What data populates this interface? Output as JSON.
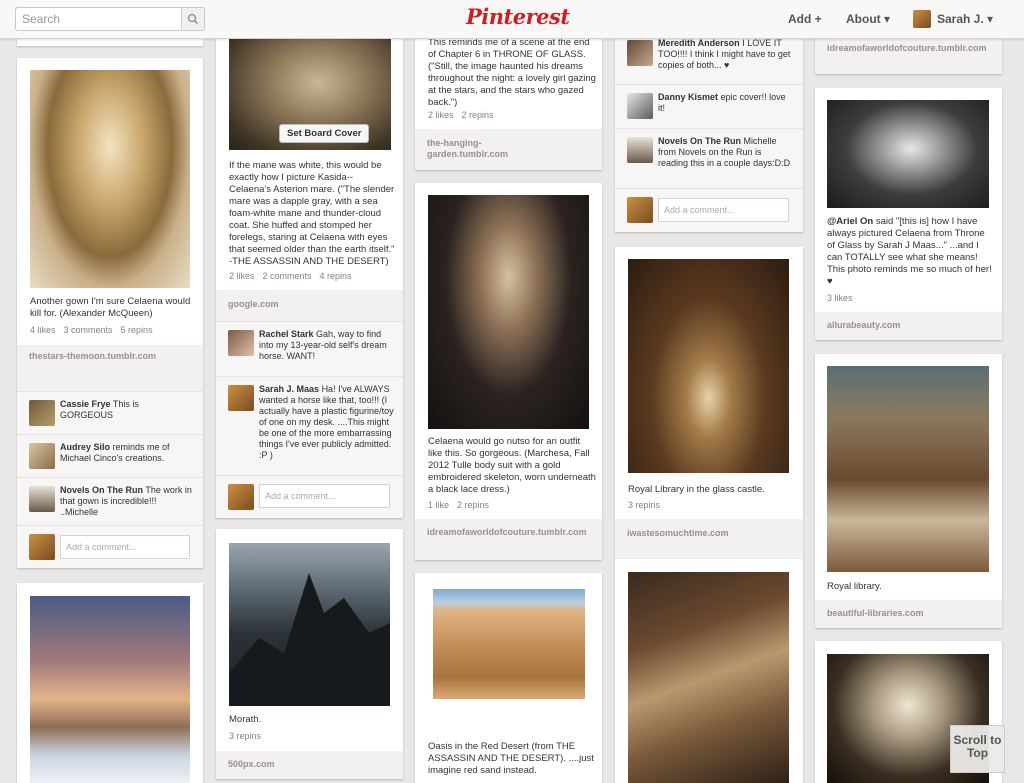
{
  "header": {
    "search_placeholder": "Search",
    "logo": "Pinterest",
    "add_label": "Add +",
    "about_label": "About ▾",
    "user_label": "Sarah J. ▾"
  },
  "pins": {
    "gown": {
      "desc": "Another gown I'm sure Celaena would kill for. (Alexander McQueen)",
      "likes": "4 likes",
      "comments": "3 comments",
      "repins": "5 repins",
      "source": "thestars-themoon.tumblr.com",
      "c1_name": "Cassie Frye",
      "c1_text": "This is GORGEOUS",
      "c2_name": "Audrey Silo",
      "c2_text": "reminds me of Michael Cinco's creations.",
      "c3_name": "Novels On The Run",
      "c3_text": "The work in that gown is incredible!!! ..Michelle",
      "add_comment": "Add a comment..."
    },
    "horse": {
      "set_cover": "Set Board Cover",
      "desc": "If the mane was white, this would be exactly how I picture Kasida--Celaena's Asterion mare. (\"The slender mare was a dapple gray, with a sea foam-white mane and thunder-cloud coat. She huffed and stomped her forelegs, staring at Celaena with eyes that seemed older than the earth itself.\" -THE ASSASSIN AND THE DESERT)",
      "likes": "2 likes",
      "comments": "2 comments",
      "repins": "4 repins",
      "source": "google.com",
      "c1_name": "Rachel Stark",
      "c1_text": "Gah, way to find into my 13-year-old self's dream horse. WANT!",
      "c2_name": "Sarah J. Maas",
      "c2_text": "Ha! I've ALWAYS wanted a horse like that, too!!! (I actually have a plastic figurine/toy of one on my desk. ....This might be one of the more embarrassing things I've ever publicly admitted. :P )",
      "add_comment": "Add a comment..."
    },
    "scene": {
      "desc": "This reminds me of a scene at the end of Chapter 6 in THRONE OF GLASS. (\"Still, the image haunted his dreams throughout the night: a lovely girl gazing at the stars, and the stars who gazed back.\")",
      "likes": "2 likes",
      "repins": "2 repins",
      "source": "the-hanging-garden.tumblr.com"
    },
    "skeleton": {
      "desc": "Celaena would go nutso for an outfit like this. So gorgeous. (Marchesa, Fall 2012 Tulle body suit with a gold embroidered skeleton, worn underneath a black lace dress.)",
      "likes": "1 like",
      "repins": "2 repins",
      "source": "idreamofaworldofcouture.tumblr.com"
    },
    "comments_top": {
      "c1_name": "Meredith Anderson",
      "c1_text": "I LOVE IT TOO!!!! I think I might have to get copies of both... ♥",
      "c2_name": "Danny Kismet",
      "c2_text": "epic cover!! love it!",
      "c3_name": "Novels On The Run",
      "c3_text": "Michelle from Novels on the Run is reading this in a couple days:D:D",
      "add_comment": "Add a comment..."
    },
    "library": {
      "desc": "Royal Library in the glass castle.",
      "repins": "3 repins",
      "source": "iwastesomuchtime.com"
    },
    "col5_top": {
      "source": "idreamofaworldofcouture.tumblr.com"
    },
    "ariel": {
      "name": "@Ariel On",
      "desc": " said \"[this is] how I have always pictured Celaena from Throne of Glass by Sarah J Maas...\" ...and I can TOTALLY see what she means! This photo reminds me so much of her! ♥",
      "likes": "3 likes",
      "source": "allurabeauty.com"
    },
    "royal": {
      "desc": "Royal library.",
      "source": "beautiful-libraries.com"
    },
    "mountains": {
      "desc": "Morath.",
      "repins": "3 repins",
      "source": "500px.com"
    },
    "desert": {
      "desc": "Oasis in the Red Desert (from THE ASSASSIN AND THE DESERT). ....just imagine red sand instead."
    }
  },
  "scroll_top": "Scroll to Top",
  "colors": {
    "brand": "#cb2027",
    "background": "#eae8e6"
  }
}
